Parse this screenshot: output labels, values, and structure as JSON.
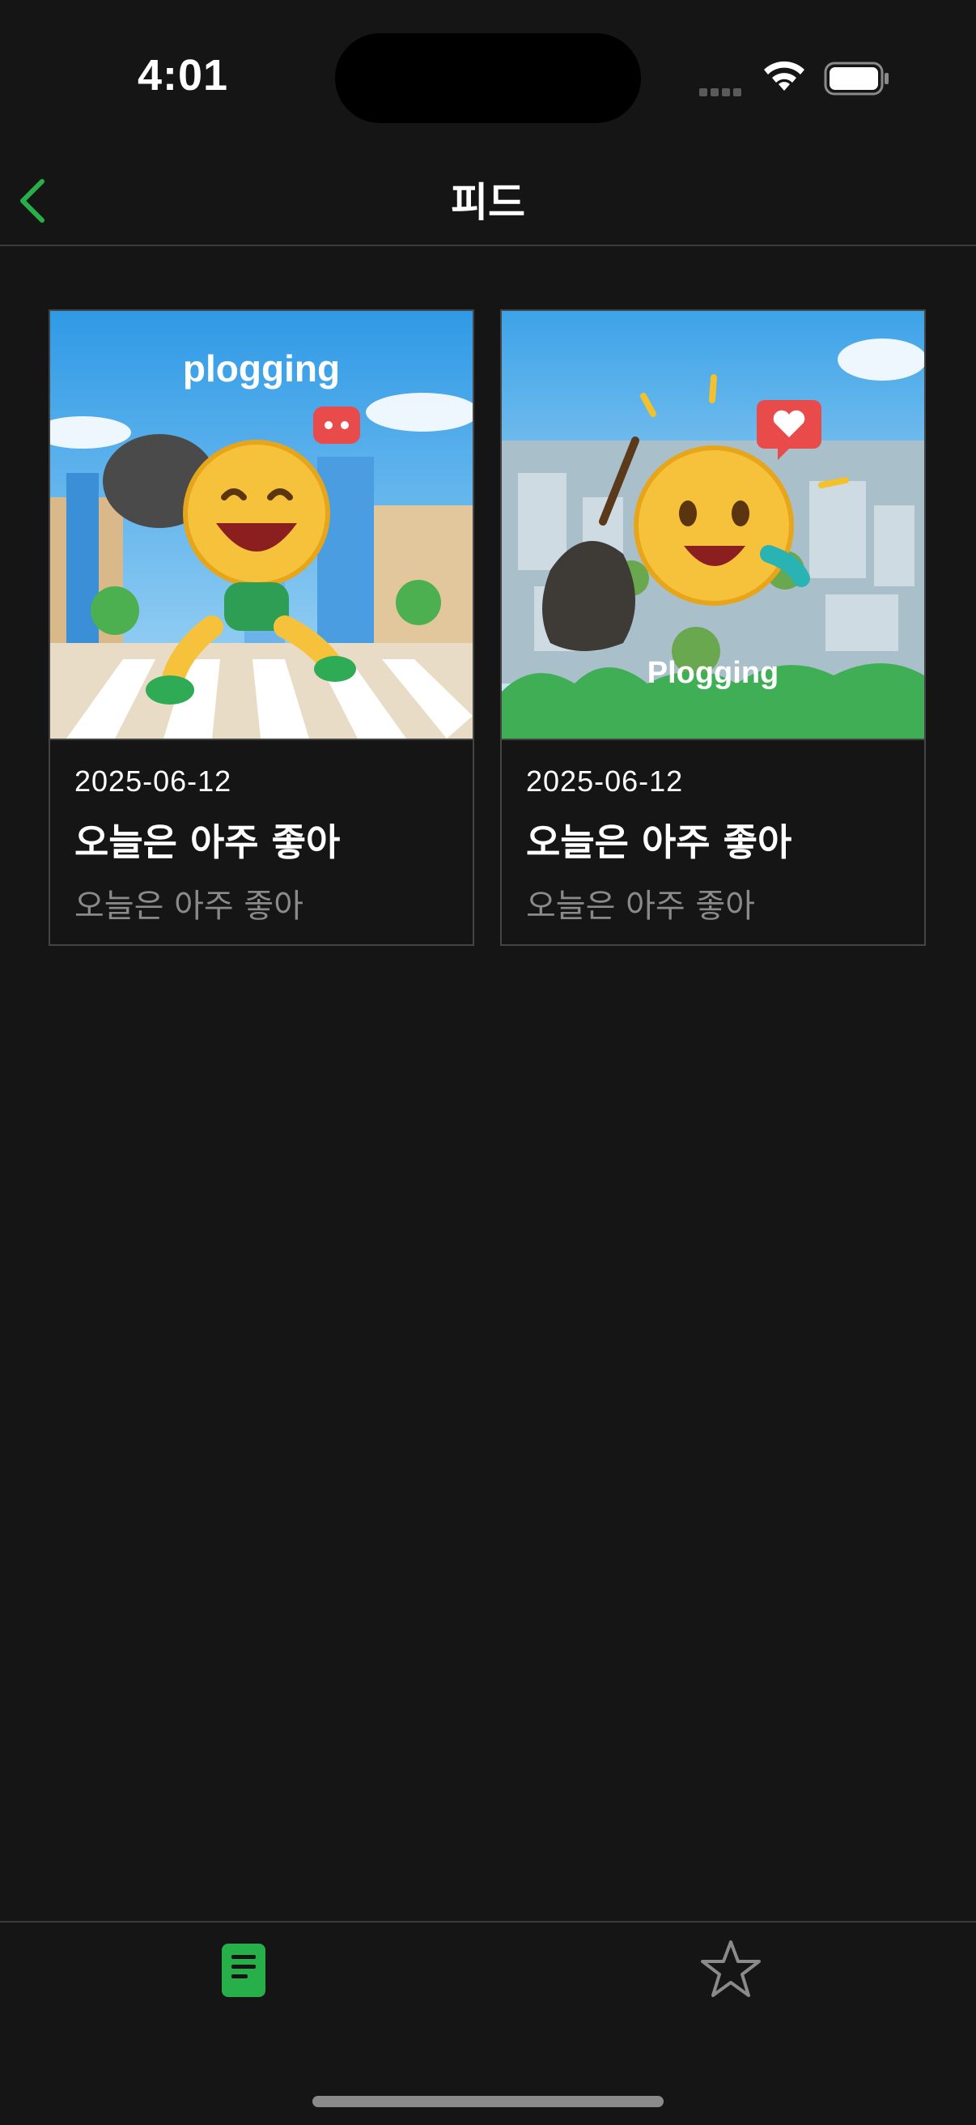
{
  "status_bar": {
    "time": "4:01"
  },
  "header": {
    "title": "피드"
  },
  "feed": {
    "cards": [
      {
        "image_caption": "plogging",
        "date": "2025-06-12",
        "title": "오늘은 아주 좋아",
        "subtitle": "오늘은 아주 좋아"
      },
      {
        "image_caption": "Plogging",
        "date": "2025-06-12",
        "title": "오늘은 아주 좋아",
        "subtitle": "오늘은 아주 좋아"
      }
    ]
  },
  "tab_bar": {
    "tabs": [
      {
        "icon": "document-icon",
        "active": true
      },
      {
        "icon": "star-icon",
        "active": false
      }
    ]
  },
  "colors": {
    "accent": "#27b04a",
    "background": "#151515",
    "muted_text": "#8a8a8a"
  }
}
